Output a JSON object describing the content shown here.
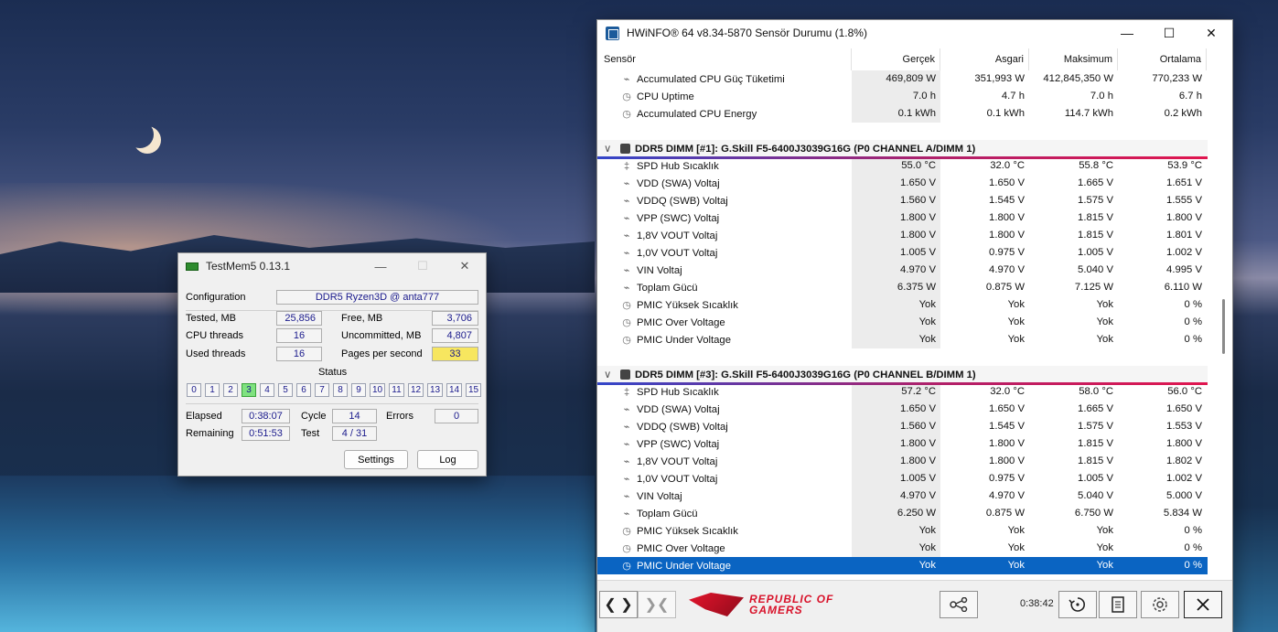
{
  "testmem": {
    "title": "TestMem5  0.13.1",
    "config_label": "Configuration",
    "config_value": "DDR5 Ryzen3D @ anta777",
    "tested_label": "Tested, MB",
    "tested_value": "25,856",
    "free_label": "Free, MB",
    "free_value": "3,706",
    "cpu_threads_label": "CPU threads",
    "cpu_threads_value": "16",
    "uncommitted_label": "Uncommitted, MB",
    "uncommitted_value": "4,807",
    "used_threads_label": "Used threads",
    "used_threads_value": "16",
    "pages_label": "Pages per second",
    "pages_value": "33",
    "status_label": "Status",
    "status_cells": [
      "0",
      "1",
      "2",
      "3",
      "4",
      "5",
      "6",
      "7",
      "8",
      "9",
      "10",
      "11",
      "12",
      "13",
      "14",
      "15"
    ],
    "status_active": "3",
    "elapsed_label": "Elapsed",
    "elapsed_value": "0:38:07",
    "cycle_label": "Cycle",
    "cycle_value": "14",
    "errors_label": "Errors",
    "errors_value": "0",
    "remaining_label": "Remaining",
    "remaining_value": "0:51:53",
    "test_label": "Test",
    "test_value": "4 / 31",
    "settings_button": "Settings",
    "log_button": "Log"
  },
  "hwinfo": {
    "title": "HWiNFO® 64 v8.34-5870 Sensör Durumu (1.8%)",
    "columns": [
      "Sensör",
      "Gerçek",
      "Asgari",
      "Maksimum",
      "Ortalama"
    ],
    "top_rows": [
      {
        "icon": "bolt",
        "name": "Accumulated CPU Güç Tüketimi",
        "v": [
          "469,809 W",
          "351,993 W",
          "412,845,350 W",
          "770,233 W"
        ]
      },
      {
        "icon": "clock",
        "name": "CPU Uptime",
        "v": [
          "7.0 h",
          "4.7 h",
          "7.0 h",
          "6.7 h"
        ]
      },
      {
        "icon": "clock",
        "name": "Accumulated CPU Energy",
        "v": [
          "0.1 kWh",
          "0.1 kWh",
          "114.7 kWh",
          "0.2 kWh"
        ]
      }
    ],
    "groups": [
      {
        "title": "DDR5 DIMM [#1]: G.Skill F5-6400J3039G16G (P0 CHANNEL A/DIMM 1)",
        "rows": [
          {
            "icon": "thermo",
            "name": "SPD Hub Sıcaklık",
            "v": [
              "55.0 °C",
              "32.0 °C",
              "55.8 °C",
              "53.9 °C"
            ]
          },
          {
            "icon": "bolt",
            "name": "VDD (SWA) Voltaj",
            "v": [
              "1.650 V",
              "1.650 V",
              "1.665 V",
              "1.651 V"
            ]
          },
          {
            "icon": "bolt",
            "name": "VDDQ (SWB) Voltaj",
            "v": [
              "1.560 V",
              "1.545 V",
              "1.575 V",
              "1.555 V"
            ]
          },
          {
            "icon": "bolt",
            "name": "VPP (SWC) Voltaj",
            "v": [
              "1.800 V",
              "1.800 V",
              "1.815 V",
              "1.800 V"
            ]
          },
          {
            "icon": "bolt",
            "name": "1,8V VOUT Voltaj",
            "v": [
              "1.800 V",
              "1.800 V",
              "1.815 V",
              "1.801 V"
            ]
          },
          {
            "icon": "bolt",
            "name": "1,0V VOUT Voltaj",
            "v": [
              "1.005 V",
              "0.975 V",
              "1.005 V",
              "1.002 V"
            ]
          },
          {
            "icon": "bolt",
            "name": "VIN Voltaj",
            "v": [
              "4.970 V",
              "4.970 V",
              "5.040 V",
              "4.995 V"
            ]
          },
          {
            "icon": "bolt",
            "name": "Toplam Gücü",
            "v": [
              "6.375 W",
              "0.875 W",
              "7.125 W",
              "6.110 W"
            ]
          },
          {
            "icon": "clock",
            "name": "PMIC Yüksek Sıcaklık",
            "v": [
              "Yok",
              "Yok",
              "Yok",
              "0 %"
            ]
          },
          {
            "icon": "clock",
            "name": "PMIC Over Voltage",
            "v": [
              "Yok",
              "Yok",
              "Yok",
              "0 %"
            ]
          },
          {
            "icon": "clock",
            "name": "PMIC Under Voltage",
            "v": [
              "Yok",
              "Yok",
              "Yok",
              "0 %"
            ]
          }
        ]
      },
      {
        "title": "DDR5 DIMM [#3]: G.Skill F5-6400J3039G16G (P0 CHANNEL B/DIMM 1)",
        "rows": [
          {
            "icon": "thermo",
            "name": "SPD Hub Sıcaklık",
            "v": [
              "57.2 °C",
              "32.0 °C",
              "58.0 °C",
              "56.0 °C"
            ]
          },
          {
            "icon": "bolt",
            "name": "VDD (SWA) Voltaj",
            "v": [
              "1.650 V",
              "1.650 V",
              "1.665 V",
              "1.650 V"
            ]
          },
          {
            "icon": "bolt",
            "name": "VDDQ (SWB) Voltaj",
            "v": [
              "1.560 V",
              "1.545 V",
              "1.575 V",
              "1.553 V"
            ]
          },
          {
            "icon": "bolt",
            "name": "VPP (SWC) Voltaj",
            "v": [
              "1.800 V",
              "1.800 V",
              "1.815 V",
              "1.800 V"
            ]
          },
          {
            "icon": "bolt",
            "name": "1,8V VOUT Voltaj",
            "v": [
              "1.800 V",
              "1.800 V",
              "1.815 V",
              "1.802 V"
            ]
          },
          {
            "icon": "bolt",
            "name": "1,0V VOUT Voltaj",
            "v": [
              "1.005 V",
              "0.975 V",
              "1.005 V",
              "1.002 V"
            ]
          },
          {
            "icon": "bolt",
            "name": "VIN Voltaj",
            "v": [
              "4.970 V",
              "4.970 V",
              "5.040 V",
              "5.000 V"
            ]
          },
          {
            "icon": "bolt",
            "name": "Toplam Gücü",
            "v": [
              "6.250 W",
              "0.875 W",
              "6.750 W",
              "5.834 W"
            ]
          },
          {
            "icon": "clock",
            "name": "PMIC Yüksek Sıcaklık",
            "v": [
              "Yok",
              "Yok",
              "Yok",
              "0 %"
            ]
          },
          {
            "icon": "clock",
            "name": "PMIC Over Voltage",
            "v": [
              "Yok",
              "Yok",
              "Yok",
              "0 %"
            ]
          },
          {
            "icon": "clock",
            "name": "PMIC Under Voltage",
            "v": [
              "Yok",
              "Yok",
              "Yok",
              "0 %"
            ],
            "selected": true
          }
        ]
      }
    ],
    "footer": {
      "timer": "0:38:42",
      "rog_line1": "REPUBLIC OF",
      "rog_line2": "GAMERS"
    },
    "colors": {
      "selection": "#0a64c2",
      "group_bar_start": "#3346c9",
      "group_bar_end": "#e0164f"
    }
  }
}
